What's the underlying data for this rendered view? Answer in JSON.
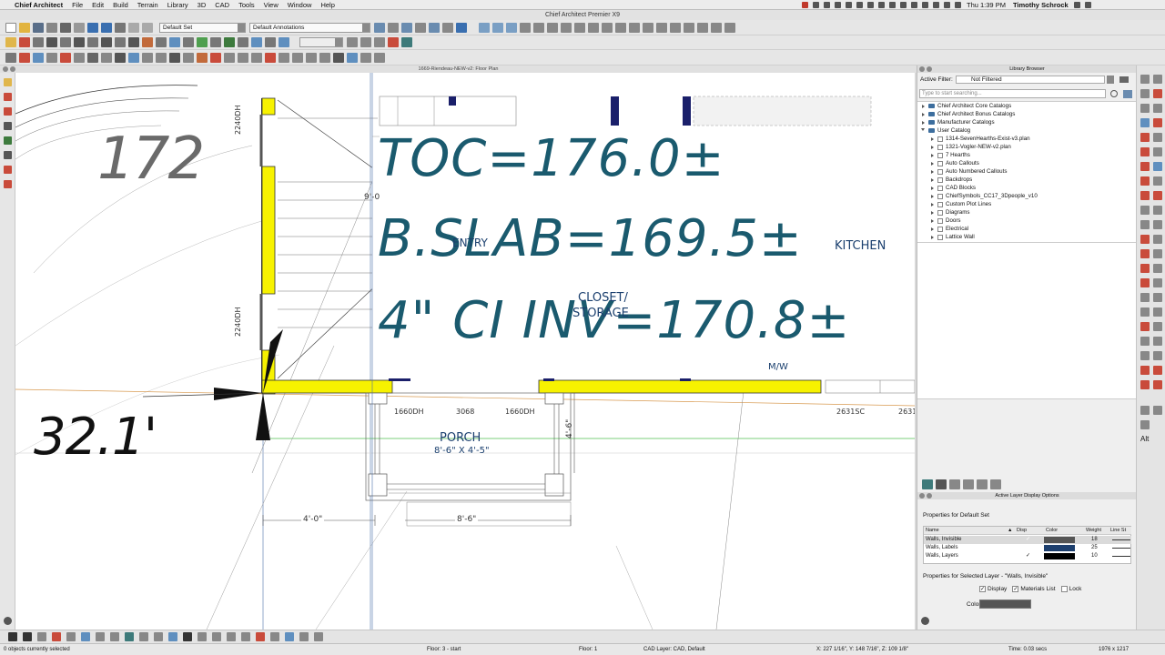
{
  "menubar": {
    "app": "Chief Architect",
    "items": [
      "File",
      "Edit",
      "Build",
      "Terrain",
      "Library",
      "3D",
      "CAD",
      "Tools",
      "View",
      "Window",
      "Help"
    ],
    "clock": "Thu 1:39 PM",
    "user": "Timothy Schrock"
  },
  "window_title": "Chief Architect Premier X9",
  "toolbar": {
    "layer_set": "Default Set",
    "annotation_set": "Default Annotations"
  },
  "plan": {
    "tab_title": "1669-Riendeau-NEW-v2: Floor Plan",
    "annotations": {
      "toc": "TOC=176.0±",
      "slab": "B.SLAB=169.5±",
      "ci": "4\" CI INV=170.8±",
      "elev_172": "172",
      "dim_32": "32.1'"
    },
    "labels": {
      "entry": "ENTRY",
      "kitchen": "KITCHEN",
      "closet_1": "CLOSET/",
      "closet_2": "STORAGE",
      "porch": "PORCH",
      "porch_size": "8'-6\" X 4'-5\"",
      "mw": "M/W",
      "window_upper": "2240DH",
      "window_lower": "2240DH",
      "window_left": "1660DH",
      "door": "3068",
      "window_right": "1660DH",
      "window_kitchen": "2631SC",
      "window_partial": "2631",
      "dim_vertical": "4'-6\"",
      "dim_4_0": "4'-0\"",
      "dim_8_6": "8'-6\"",
      "dim_9": "9'-0"
    }
  },
  "library": {
    "title": "Library Browser",
    "filter_label": "Active Filter:",
    "filter_value": "Not Filtered",
    "search_placeholder": "Type to start searching...",
    "top_items": [
      "Chief Architect Core Catalogs",
      "Chief Architect Bonus Catalogs",
      "Manufacturer Catalogs",
      "User Catalog"
    ],
    "user_items": [
      "1314-SevenHearths-Exist-v3.plan",
      "1321-Vogler-NEW-v2.plan",
      "7 Hearths",
      "Auto Callouts",
      "Auto Numbered Callouts",
      "Backdrops",
      "CAD Blocks",
      "ChiefSymbols_CC17_3Dpeople_v10",
      "Custom Plot Lines",
      "Diagrams",
      "Doors",
      "Electrical",
      "Lattice Wall"
    ]
  },
  "layers": {
    "title": "Active Layer Display Options",
    "properties_for": "Properties for Default Set",
    "columns": {
      "name": "Name",
      "disp": "Disp",
      "color": "Color",
      "weight": "Weight",
      "linestyle": "Line St"
    },
    "rows": [
      {
        "name": "Walls, Invisible",
        "disp": "✓",
        "color": "#555555",
        "weight": "18"
      },
      {
        "name": "Walls, Labels",
        "disp": "",
        "color": "#1d3f6e",
        "weight": "25"
      },
      {
        "name": "Walls, Layers",
        "disp": "✓",
        "color": "#000000",
        "weight": "10"
      }
    ],
    "selected_props": "Properties for Selected Layer - \"Walls, Invisible\"",
    "display_label": "Display",
    "materials_label": "Materials List",
    "lock_label": "Lock",
    "color_label": "Color:"
  },
  "status": {
    "selection": "0 objects currently selected",
    "floor_mid": "Floor: 3 - start",
    "floor": "Floor: 1",
    "cad_layer": "CAD Layer: CAD,  Default",
    "coords": "X: 227 1/16\", Y: 148 7/16\", Z: 109 1/8\"",
    "time": "Time: 0.03 secs",
    "resolution": "1976 x 1217"
  },
  "right_tools_alt": "Alt",
  "colors": {
    "wall_yellow": "#f7f200",
    "annotation_teal": "#1a5a6e",
    "window_navy": "#1a1f6a"
  }
}
